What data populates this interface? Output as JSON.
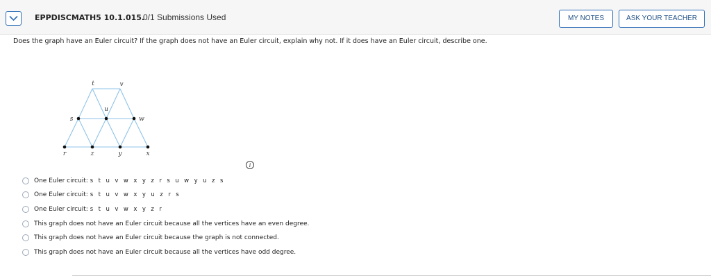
{
  "header": {
    "question_id": "EPPDISCMATH5 10.1.015.",
    "submissions": "0/1 Submissions Used",
    "my_notes_label": "MY NOTES",
    "ask_teacher_label": "ASK YOUR TEACHER",
    "toggle_icon": "chevron-down-icon",
    "accent_color": "#2d6db5"
  },
  "question": {
    "text": "Does the graph have an Euler circuit? If the graph does not have an Euler circuit, explain why not. If it does have an Euler circuit, describe one."
  },
  "graph": {
    "vertex_labels": {
      "t": "t",
      "v": "v",
      "u": "u",
      "s": "s",
      "w": "w",
      "r": "r",
      "z": "z",
      "y": "y",
      "x": "x"
    },
    "edge_color": "#8fc3ea",
    "vertex_color": "#111111"
  },
  "info_icon": "i",
  "options": [
    {
      "prefix": "One Euler circuit: ",
      "path": "s t u v w x y z r s u w y u z s",
      "suffix": ""
    },
    {
      "prefix": "One Euler circuit: ",
      "path": "s t u v w x y u z r s",
      "suffix": ""
    },
    {
      "prefix": "One Euler circuit: ",
      "path": "s t u v w x y z r",
      "suffix": ""
    },
    {
      "prefix": "This graph does not have an Euler circuit because all the vertices have an even degree.",
      "path": "",
      "suffix": ""
    },
    {
      "prefix": "This graph does not have an Euler circuit because the graph is not connected.",
      "path": "",
      "suffix": ""
    },
    {
      "prefix": "This graph does not have an Euler circuit because all the vertices have odd degree.",
      "path": "",
      "suffix": ""
    }
  ]
}
